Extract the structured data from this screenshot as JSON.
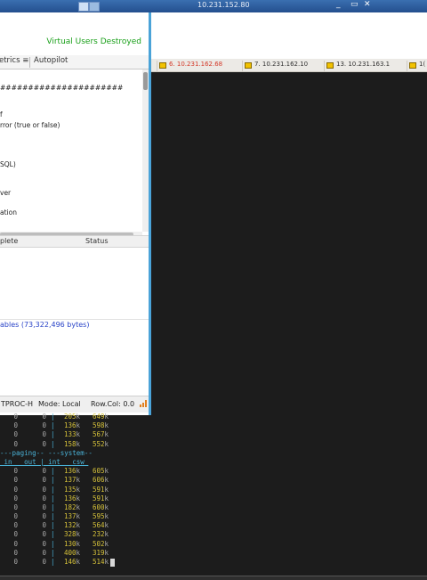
{
  "remote_bar": {
    "title": "10.231.152.80",
    "window_controls": [
      "_",
      "▭",
      "✕"
    ]
  },
  "terminal_tabs": [
    {
      "label": "6. 10.231.162.68",
      "active": true
    },
    {
      "label": "7. 10.231.162.10"
    },
    {
      "label": "13. 10.231.163.1"
    },
    {
      "label": "1("
    }
  ],
  "hammerdb": {
    "status_message": "Virtual Users Destroyed",
    "tabs": [
      "etrics ≡",
      "Autopilot"
    ],
    "script_lines": [
      "######################",
      "f",
      "rror (true or false)",
      "SQL)",
      "ver",
      "ation"
    ],
    "table_headers": [
      "plete",
      "Status"
    ],
    "tables_message": "ables (73,322,496 bytes)",
    "statusbar": {
      "benchmark": "TPROC-H",
      "mode": "Mode: Local",
      "rowcol": "Row.Col: 0.0"
    }
  },
  "vmstat": {
    "top_rows": [
      [
        "0",
        "0",
        "205k",
        "649k"
      ],
      [
        "0",
        "0",
        "136k",
        "598k"
      ],
      [
        "0",
        "0",
        "133k",
        "567k"
      ],
      [
        "0",
        "0",
        "158k",
        "552k"
      ]
    ],
    "group_header": "---paging-- ---system--",
    "column_header": " in   out | int   csw ",
    "rows": [
      [
        "0",
        "0",
        "136k",
        "605k"
      ],
      [
        "0",
        "0",
        "137k",
        "606k"
      ],
      [
        "0",
        "0",
        "135k",
        "591k"
      ],
      [
        "0",
        "0",
        "136k",
        "591k"
      ],
      [
        "0",
        "0",
        "182k",
        "600k"
      ],
      [
        "0",
        "0",
        "137k",
        "595k"
      ],
      [
        "0",
        "0",
        "132k",
        "564k"
      ],
      [
        "0",
        "0",
        "328k",
        "232k"
      ],
      [
        "0",
        "0",
        "130k",
        "502k"
      ],
      [
        "0",
        "0",
        "400k",
        "319k"
      ],
      [
        "0",
        "0",
        "146k",
        "514k"
      ]
    ]
  },
  "colors": {
    "status_ok": "#1aa01a",
    "link_blue": "#2a44c8",
    "accent": "#4aa3d8",
    "terminal_bg": "#1c1c1c"
  }
}
